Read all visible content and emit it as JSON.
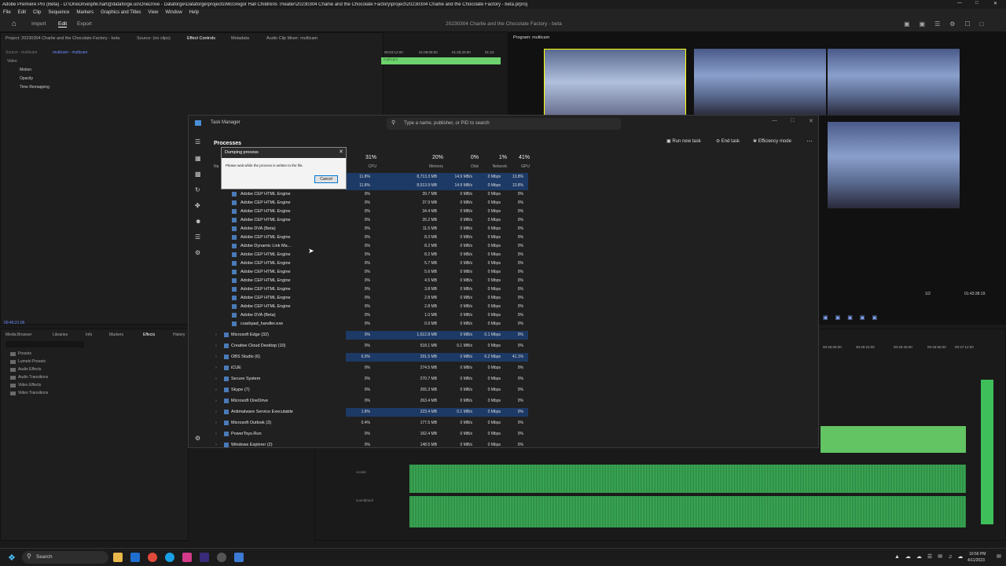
{
  "window_title": "Adobe Premiere Pro (Beta) - D:\\OneDrive\\phil.hart@dataforge.us\\OneDrive - Dataforge\\Dataforge\\projects\\McGregor Hall Childrens Theater\\20230304 Charlie and the Chocolate Factory\\project\\20230304 Charlie and the Chocolate Factory - beta.prproj",
  "menu": [
    "File",
    "Edit",
    "Clip",
    "Sequence",
    "Markers",
    "Graphics and Titles",
    "View",
    "Window",
    "Help"
  ],
  "workspace_tabs": [
    "Import",
    "Edit",
    "Export"
  ],
  "toolbar_title": "20230304 Charlie and the Chocolate Factory - beta",
  "source_panel": {
    "project": "Project: 20230304 Charlie and the Chocolate Factory - beta",
    "source": "Source: (no clips)",
    "effect_controls": "Effect Controls",
    "metadata": "Metadata",
    "audio_mixer": "Audio Clip Mixer: multicam",
    "sequence_path": "Source - multicam",
    "sequence_link": "multicam - multicam",
    "video_label": "Video",
    "effects": [
      "Motion",
      "Opacity",
      "Time Remapping"
    ],
    "timecodes": [
      "00:53:12:00",
      "01:08:08:00",
      "01:25:20:00",
      "01:42:"
    ],
    "clip_label": "multicam",
    "current_time": "00:45:21:06"
  },
  "program_monitor": {
    "label": "Program: multicam",
    "fraction": "1/2",
    "duration": "01:43:38:19"
  },
  "effects_panel": {
    "tabs": [
      "Media Browser",
      "Libraries",
      "Info",
      "Markers",
      "Effects",
      "History"
    ],
    "items": [
      "Presets",
      "Lumetri Presets",
      "Audio Effects",
      "Audio Transitions",
      "Video Effects",
      "Video Transitions"
    ]
  },
  "timeline": {
    "timecodes": [
      "00:46:08:00",
      "00:46:24:00",
      "00:46:40:00",
      "00:46:56:00",
      "00:47:12:00"
    ],
    "track_labels": [
      "vocals",
      "soundtrack"
    ]
  },
  "task_manager": {
    "title": "Task Manager",
    "search_placeholder": "Type a name, publisher, or PID to search",
    "section": "Processes",
    "actions": {
      "run": "Run new task",
      "end": "End task",
      "efficiency": "Efficiency mode"
    },
    "columns": [
      {
        "pct": "31%",
        "label": "CPU"
      },
      {
        "pct": "20%",
        "label": "Memory"
      },
      {
        "pct": "0%",
        "label": "Disk"
      },
      {
        "pct": "1%",
        "label": "Network"
      },
      {
        "pct": "41%",
        "label": "GPU"
      }
    ],
    "name_col": "Na",
    "rows": [
      {
        "name": "",
        "cpu": "11.8%",
        "mem": "8,713.3 MB",
        "disk": "14.9 MB/s",
        "net": "0 Mbps",
        "gpu": "13.8%",
        "hl": true
      },
      {
        "name": "",
        "cpu": "11.8%",
        "mem": "8,513.9 MB",
        "disk": "14.9 MB/s",
        "net": "0 Mbps",
        "gpu": "13.8%",
        "hl": true
      },
      {
        "name": "Adobe CEP HTML Engine",
        "cpu": "0%",
        "mem": "39.7 MB",
        "disk": "0 MB/s",
        "net": "0 Mbps",
        "gpu": "0%"
      },
      {
        "name": "Adobe CEP HTML Engine",
        "cpu": "0%",
        "mem": "37.9 MB",
        "disk": "0 MB/s",
        "net": "0 Mbps",
        "gpu": "0%"
      },
      {
        "name": "Adobe CEP HTML Engine",
        "cpu": "0%",
        "mem": "34.4 MB",
        "disk": "0 MB/s",
        "net": "0 Mbps",
        "gpu": "0%"
      },
      {
        "name": "Adobe CEP HTML Engine",
        "cpu": "0%",
        "mem": "26.2 MB",
        "disk": "0 MB/s",
        "net": "0 Mbps",
        "gpu": "0%"
      },
      {
        "name": "Adobe DVA (Beta)",
        "cpu": "0%",
        "mem": "11.5 MB",
        "disk": "0 MB/s",
        "net": "0 Mbps",
        "gpu": "0%"
      },
      {
        "name": "Adobe CEP HTML Engine",
        "cpu": "0%",
        "mem": "8.3 MB",
        "disk": "0 MB/s",
        "net": "0 Mbps",
        "gpu": "0%"
      },
      {
        "name": "Adobe Dynamic Link Ma...",
        "cpu": "0%",
        "mem": "8.2 MB",
        "disk": "0 MB/s",
        "net": "0 Mbps",
        "gpu": "0%"
      },
      {
        "name": "Adobe CEP HTML Engine",
        "cpu": "0%",
        "mem": "8.2 MB",
        "disk": "0 MB/s",
        "net": "0 Mbps",
        "gpu": "0%"
      },
      {
        "name": "Adobe CEP HTML Engine",
        "cpu": "0%",
        "mem": "5.7 MB",
        "disk": "0 MB/s",
        "net": "0 Mbps",
        "gpu": "0%"
      },
      {
        "name": "Adobe CEP HTML Engine",
        "cpu": "0%",
        "mem": "5.6 MB",
        "disk": "0 MB/s",
        "net": "0 Mbps",
        "gpu": "0%"
      },
      {
        "name": "Adobe CEP HTML Engine",
        "cpu": "0%",
        "mem": "4.5 MB",
        "disk": "0 MB/s",
        "net": "0 Mbps",
        "gpu": "0%"
      },
      {
        "name": "Adobe CEP HTML Engine",
        "cpu": "0%",
        "mem": "3.8 MB",
        "disk": "0 MB/s",
        "net": "0 Mbps",
        "gpu": "0%"
      },
      {
        "name": "Adobe CEP HTML Engine",
        "cpu": "0%",
        "mem": "2.8 MB",
        "disk": "0 MB/s",
        "net": "0 Mbps",
        "gpu": "0%"
      },
      {
        "name": "Adobe CEP HTML Engine",
        "cpu": "0%",
        "mem": "2.8 MB",
        "disk": "0 MB/s",
        "net": "0 Mbps",
        "gpu": "0%"
      },
      {
        "name": "Adobe DVA (Beta)",
        "cpu": "0%",
        "mem": "1.0 MB",
        "disk": "0 MB/s",
        "net": "0 Mbps",
        "gpu": "0%"
      },
      {
        "name": "crashpad_handler.exe",
        "cpu": "0%",
        "mem": "0.9 MB",
        "disk": "0 MB/s",
        "net": "0 Mbps",
        "gpu": "0%"
      }
    ],
    "groups": [
      {
        "name": "Microsoft Edge (32)",
        "cpu": "0%",
        "mem": "1,612.8 MB",
        "disk": "0 MB/s",
        "net": "0.1 Mbps",
        "gpu": "0%",
        "hl": true
      },
      {
        "name": "Creative Cloud Desktop (10)",
        "cpu": "0%",
        "mem": "518.1 MB",
        "disk": "0.1 MB/s",
        "net": "0 Mbps",
        "gpu": "0%"
      },
      {
        "name": "OBS Studio (6)",
        "cpu": "6.0%",
        "mem": "291.5 MB",
        "disk": "0 MB/s",
        "net": "6.2 Mbps",
        "gpu": "41.1%",
        "hl": true
      },
      {
        "name": "iCUE",
        "cpu": "0%",
        "mem": "274.5 MB",
        "disk": "0 MB/s",
        "net": "0 Mbps",
        "gpu": "0%"
      },
      {
        "name": "Secure System",
        "cpu": "0%",
        "mem": "270.7 MB",
        "disk": "0 MB/s",
        "net": "0 Mbps",
        "gpu": "0%"
      },
      {
        "name": "Skype (7)",
        "cpu": "0%",
        "mem": "265.3 MB",
        "disk": "0 MB/s",
        "net": "0 Mbps",
        "gpu": "0%"
      },
      {
        "name": "Microsoft OneDrive",
        "cpu": "0%",
        "mem": "263.4 MB",
        "disk": "0 MB/s",
        "net": "0 Mbps",
        "gpu": "0%"
      },
      {
        "name": "Antimalware Service Executable",
        "cpu": "1.8%",
        "mem": "223.4 MB",
        "disk": "0.1 MB/s",
        "net": "0 Mbps",
        "gpu": "0%",
        "hl": true
      },
      {
        "name": "Microsoft Outlook (3)",
        "cpu": "0.4%",
        "mem": "177.5 MB",
        "disk": "0 MB/s",
        "net": "0 Mbps",
        "gpu": "0%"
      },
      {
        "name": "PowerToys.Run",
        "cpu": "0%",
        "mem": "162.4 MB",
        "disk": "0 MB/s",
        "net": "0 Mbps",
        "gpu": "0%"
      },
      {
        "name": "Windows Explorer (2)",
        "cpu": "0%",
        "mem": "148.5 MB",
        "disk": "0 MB/s",
        "net": "0 Mbps",
        "gpu": "0%"
      }
    ]
  },
  "dialog": {
    "title": "Dumping process",
    "message": "Please wait while the process is written to the file.",
    "cancel": "Cancel"
  },
  "taskbar": {
    "search": "Search",
    "time": "10:56 PM",
    "date": "4/11/2023"
  }
}
